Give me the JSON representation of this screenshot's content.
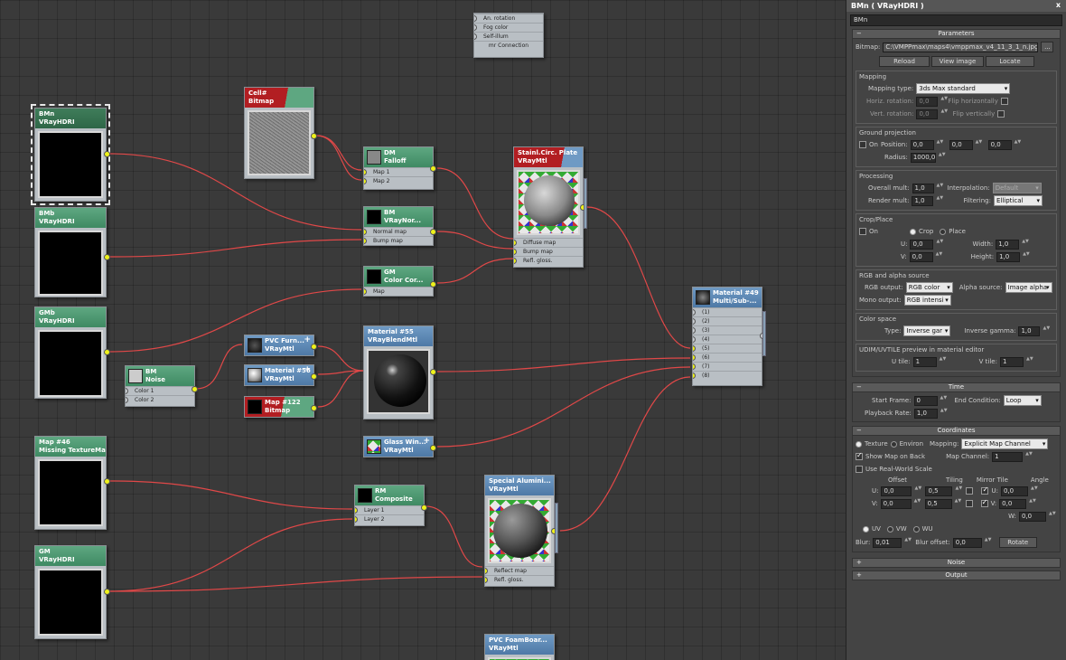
{
  "nodes": {
    "top": {
      "slots": [
        "An. rotation",
        "Fog color",
        "Self-illum",
        "mr Connection"
      ]
    },
    "bitmap": {
      "title": "Cell#",
      "subtitle": "Bitmap"
    },
    "bmn": {
      "title": "BMn",
      "subtitle": "VRayHDRI"
    },
    "bmb": {
      "title": "BMb",
      "subtitle": "VRayHDRI"
    },
    "gmb": {
      "title": "GMb",
      "subtitle": "VRayHDRI"
    },
    "falloff": {
      "title": "DM",
      "subtitle": "Falloff",
      "slots": [
        "Map 1",
        "Map 2"
      ]
    },
    "vraynormal": {
      "title": "BM",
      "subtitle": "VRayNor...",
      "slots": [
        "Normal map",
        "Bump map"
      ]
    },
    "colorcorr": {
      "title": "GM",
      "subtitle": "Color Cor...",
      "slots": [
        "Map"
      ]
    },
    "stainless": {
      "title": "Stainl.Circ. Plate",
      "subtitle": "VRayMtl",
      "slots": [
        "Diffuse map",
        "Bump map",
        "Refl. gloss."
      ]
    },
    "noise": {
      "title": "BM",
      "subtitle": "Noise",
      "slots": [
        "Color 1",
        "Color 2"
      ]
    },
    "pvcfurn": {
      "title": "PVC Furn...",
      "subtitle": "VRayMtl"
    },
    "mat56": {
      "title": "Material #56",
      "subtitle": "VRayMtl"
    },
    "map122": {
      "title": "Map #122",
      "subtitle": "Bitmap"
    },
    "mat55": {
      "title": "Material #55",
      "subtitle": "VRayBlendMtl"
    },
    "glass": {
      "title": "Glass Win...",
      "subtitle": "VRayMtl"
    },
    "mat49": {
      "title": "Material #49",
      "subtitle": "Multi/Sub-...",
      "slots": [
        "(1)",
        "(2)",
        "(3)",
        "(4)",
        "(5)",
        "(6)",
        "(7)",
        "(8)"
      ]
    },
    "map46": {
      "title": "Map #46",
      "subtitle": "Missing TextureMap"
    },
    "rm": {
      "title": "RM",
      "subtitle": "Composite",
      "slots": [
        "Layer 1",
        "Layer 2"
      ]
    },
    "gm": {
      "title": "GM",
      "subtitle": "VRayHDRI"
    },
    "specialalu": {
      "title": "Special Alumini...",
      "subtitle": "VRayMtl",
      "slots": [
        "Reflect map",
        "Refl. gloss."
      ]
    },
    "pvcfoam": {
      "title": "PVC FoamBoar...",
      "subtitle": "VRayMtl"
    }
  },
  "panel": {
    "title": "BMn  ( VRayHDRI )",
    "close": "x",
    "name": "BMn",
    "parameters": {
      "header": "Parameters",
      "bitmap_label": "Bitmap:",
      "bitmap_path": "C:\\VMPPmax\\maps4\\vmppmax_v4_11_3_1_n.jpg",
      "browse": "...",
      "reload": "Reload",
      "view_image": "View image",
      "locate": "Locate",
      "mapping": {
        "title": "Mapping",
        "type_label": "Mapping type:",
        "type_value": "3ds Max standard",
        "hrot_label": "Horiz. rotation:",
        "hrot_value": "0,0",
        "flip_h": "Flip horizontally",
        "vrot_label": "Vert. rotation:",
        "vrot_value": "0,0",
        "flip_v": "Flip vertically"
      },
      "ground": {
        "title": "Ground projection",
        "on": "On",
        "position_label": "Position:",
        "px": "0,0",
        "py": "0,0",
        "pz": "0,0",
        "radius_label": "Radius:",
        "radius_value": "1000,0"
      },
      "processing": {
        "title": "Processing",
        "overall_label": "Overall mult:",
        "overall_value": "1,0",
        "render_label": "Render mult:",
        "render_value": "1,0",
        "interp_label": "Interpolation:",
        "interp_value": "Default",
        "filter_label": "Filtering:",
        "filter_value": "Elliptical"
      },
      "crop": {
        "title": "Crop/Place",
        "on": "On",
        "crop": "Crop",
        "place": "Place",
        "u_label": "U:",
        "u_value": "0,0",
        "v_label": "V:",
        "v_value": "0,0",
        "w_label": "Width:",
        "w_value": "1,0",
        "h_label": "Height:",
        "h_value": "1,0"
      },
      "rgb": {
        "title": "RGB and alpha source",
        "rgb_label": "RGB output:",
        "rgb_value": "RGB color",
        "alpha_label": "Alpha source:",
        "alpha_value": "Image alpha",
        "mono_label": "Mono output:",
        "mono_value": "RGB intensi"
      },
      "colorspace": {
        "title": "Color space",
        "type_label": "Type:",
        "type_value": "Inverse gar",
        "gamma_label": "Inverse gamma:",
        "gamma_value": "1,0"
      },
      "udim": {
        "title": "UDIM/UVTILE preview in material editor",
        "u_label": "U tile:",
        "u_value": "1",
        "v_label": "V tile:",
        "v_value": "1"
      }
    },
    "time": {
      "header": "Time",
      "start_label": "Start Frame:",
      "start_value": "0",
      "end_label": "End Condition:",
      "end_value": "Loop",
      "rate_label": "Playback Rate:",
      "rate_value": "1,0"
    },
    "coords": {
      "header": "Coordinates",
      "texture": "Texture",
      "environ": "Environ",
      "mapping_label": "Mapping:",
      "mapping_value": "Explicit Map Channel",
      "show_map": "Show Map on Back",
      "channel_label": "Map Channel:",
      "channel_value": "1",
      "realworld": "Use Real-World Scale",
      "offset": "Offset",
      "tiling": "Tiling",
      "mirror_tile": "Mirror Tile",
      "angle": "Angle",
      "u_label": "U:",
      "v_label": "V:",
      "w_label": "W:",
      "u_offset": "0,0",
      "v_offset": "0,0",
      "u_tiling": "0,5",
      "v_tiling": "0,5",
      "u_angle": "0,0",
      "v_angle": "0,0",
      "w_angle": "0,0",
      "uv": "UV",
      "vw": "VW",
      "wu": "WU",
      "blur_label": "Blur:",
      "blur_value": "0,01",
      "bluroff_label": "Blur offset:",
      "bluroff_value": "0,0",
      "rotate": "Rotate"
    },
    "noise": {
      "header": "Noise"
    },
    "output": {
      "header": "Output"
    }
  }
}
